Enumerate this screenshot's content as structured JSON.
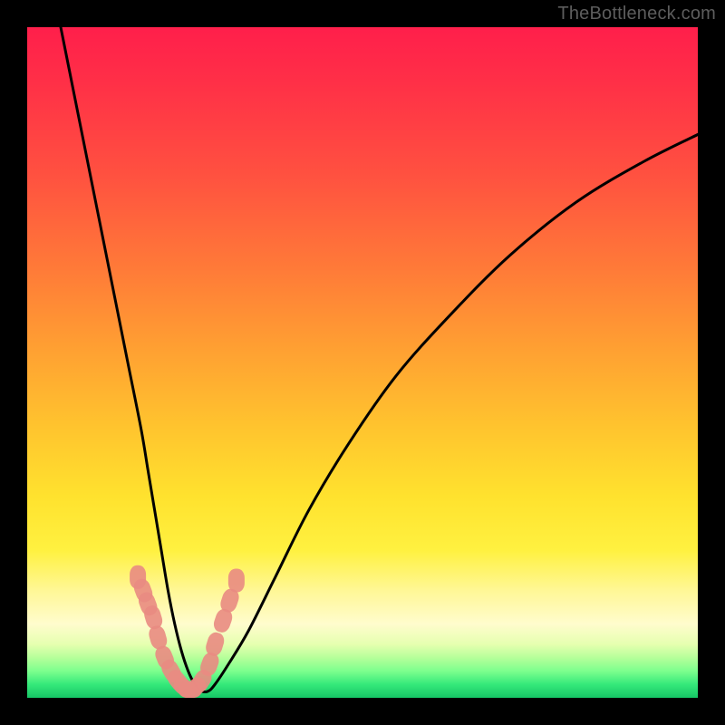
{
  "watermark": "TheBottleneck.com",
  "chart_data": {
    "type": "line",
    "title": "",
    "xlabel": "",
    "ylabel": "",
    "xlim": [
      0,
      100
    ],
    "ylim": [
      0,
      100
    ],
    "series": [
      {
        "name": "bottleneck-curve",
        "x": [
          5,
          7,
          9,
          11,
          13,
          15,
          17,
          18,
          19,
          20,
          21,
          22,
          23,
          24,
          25,
          26,
          27,
          28,
          30,
          33,
          37,
          42,
          48,
          55,
          63,
          72,
          82,
          92,
          100
        ],
        "values": [
          100,
          90,
          80,
          70,
          60,
          50,
          40,
          34,
          28,
          22,
          16,
          11,
          7,
          4,
          2,
          1,
          1,
          2,
          5,
          10,
          18,
          28,
          38,
          48,
          57,
          66,
          74,
          80,
          84
        ]
      }
    ],
    "markers": {
      "name": "highlighted-points",
      "x": [
        16.5,
        17.3,
        18.0,
        18.8,
        19.5,
        20.5,
        21.5,
        22.5,
        23.5,
        24.3,
        25.0,
        26.0,
        27.2,
        28.0,
        29.2,
        30.2,
        31.2
      ],
      "values": [
        18.0,
        16.0,
        14.0,
        12.0,
        9.0,
        6.0,
        4.0,
        2.5,
        1.5,
        1.2,
        1.5,
        2.5,
        5.0,
        8.0,
        11.5,
        14.5,
        17.5
      ]
    },
    "background_gradient": {
      "top": "#ff1f4b",
      "mid": "#ffe22e",
      "bottom": "#16c666"
    }
  }
}
